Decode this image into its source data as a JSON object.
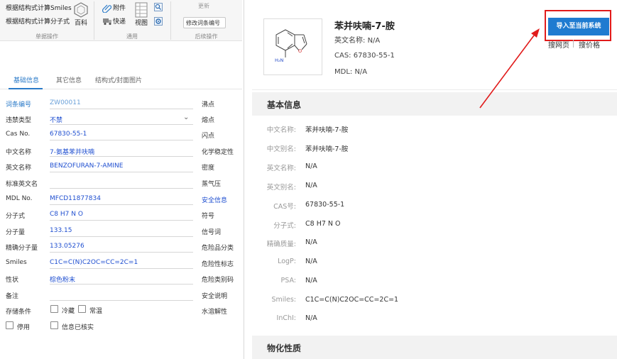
{
  "ribbon": {
    "calc_by_smiles": "根据结构式计算Smiles",
    "calc_by_formula": "根据结构式计算分子式",
    "baike": "百科",
    "attachment": "附件",
    "quick": "快递",
    "view": "视图",
    "update": "更新",
    "modify_code": "修改词条编号",
    "group_single": "单据操作",
    "group_common": "通用",
    "group_followup": "后续操作"
  },
  "tabs": [
    "基础信息",
    "其它信息",
    "结构式/封面图片"
  ],
  "form": {
    "rows": [
      {
        "label": "词条编号",
        "value": "ZW00011",
        "right": "沸点"
      },
      {
        "label": "违禁类型",
        "value": "不禁",
        "right": "熔点"
      },
      {
        "label": "Cas No.",
        "value": "67830-55-1",
        "right": "闪点"
      },
      {
        "label": "中文名称",
        "value": "7-氨基苯并呋喃",
        "right": "化学稳定性"
      },
      {
        "label": "英文名称",
        "value": "BENZOFURAN-7-AMINE",
        "right": "密度"
      },
      {
        "label": "标准英文名",
        "value": "",
        "right": "蒸气压"
      },
      {
        "label": "MDL No.",
        "value": "MFCD11877834",
        "right": "安全信息"
      },
      {
        "label": "分子式",
        "value": "C8 H7 N O",
        "right": "符号"
      },
      {
        "label": "分子量",
        "value": "133.15",
        "right": "信号词"
      },
      {
        "label": "精确分子量",
        "value": "133.05276",
        "right": "危险品分类"
      },
      {
        "label": "Smiles",
        "value": "C1C=C(N)C2OC=CC=2C=1",
        "right": "危险性标志"
      },
      {
        "label": "性状",
        "value": "棕色粉末",
        "right": "危险类别码"
      },
      {
        "label": "备注",
        "value": "",
        "right": "安全说明"
      }
    ],
    "storage_label": "存储条件",
    "storage_opt1": "冷藏",
    "storage_opt2": "常温",
    "water_solubility": "水溶解性",
    "disable_label": "停用",
    "verified_label": "信息已核实"
  },
  "product": {
    "name": "苯并呋喃-7-胺",
    "en_name_label": "英文名称: ",
    "en_name_value": "N/A",
    "cas_label": "CAS: ",
    "cas_value": "67830-55-1",
    "mdl_label": "MDL: ",
    "mdl_value": "N/A",
    "import_button": "导入至当前系统",
    "search_web": "搜网页",
    "search_price": "搜价格",
    "struct_nh2": "H₂N",
    "struct_o": "O"
  },
  "basic_info": {
    "title": "基本信息",
    "rows": [
      {
        "label": "中文名称:",
        "value": "苯并呋喃-7-胺"
      },
      {
        "label": "中文别名:",
        "value": "苯并呋喃-7-胺"
      },
      {
        "label": "英文名称:",
        "value": "N/A"
      },
      {
        "label": "英文别名:",
        "value": "N/A"
      },
      {
        "label": "CAS号:",
        "value": "67830-55-1"
      },
      {
        "label": "分子式:",
        "value": "C8 H7 N O"
      },
      {
        "label": "精确质量:",
        "value": "N/A"
      },
      {
        "label": "LogP:",
        "value": "N/A"
      },
      {
        "label": "PSA:",
        "value": "N/A"
      },
      {
        "label": "Smiles:",
        "value": "C1C=C(N)C2OC=CC=2C=1"
      },
      {
        "label": "InChI:",
        "value": "N/A"
      }
    ]
  },
  "physchem": {
    "title": "物化性质"
  },
  "colors": {
    "accent": "#1f7bd0",
    "highlight": "#e11b1b",
    "link": "#1f4fd0"
  }
}
